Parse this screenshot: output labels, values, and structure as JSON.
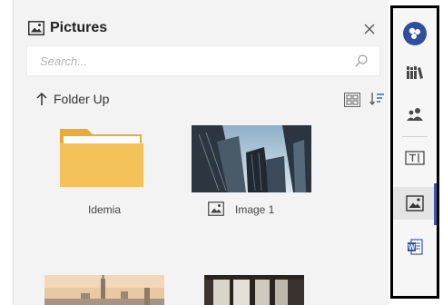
{
  "panel": {
    "title": "Pictures",
    "search_placeholder": "Search...",
    "folder_up_label": "Folder Up"
  },
  "items": [
    {
      "type": "folder",
      "label": "Idemia"
    },
    {
      "type": "image",
      "label": "Image 1"
    },
    {
      "type": "image",
      "label": ""
    },
    {
      "type": "image",
      "label": ""
    }
  ],
  "rail": {
    "buttons": [
      "app-logo",
      "library",
      "people",
      "text-block",
      "pictures",
      "word-document"
    ],
    "active": "pictures"
  },
  "colors": {
    "accent": "#3a5aa8",
    "folder": "#f3c35a",
    "pane_bg": "#f3f3f3"
  }
}
